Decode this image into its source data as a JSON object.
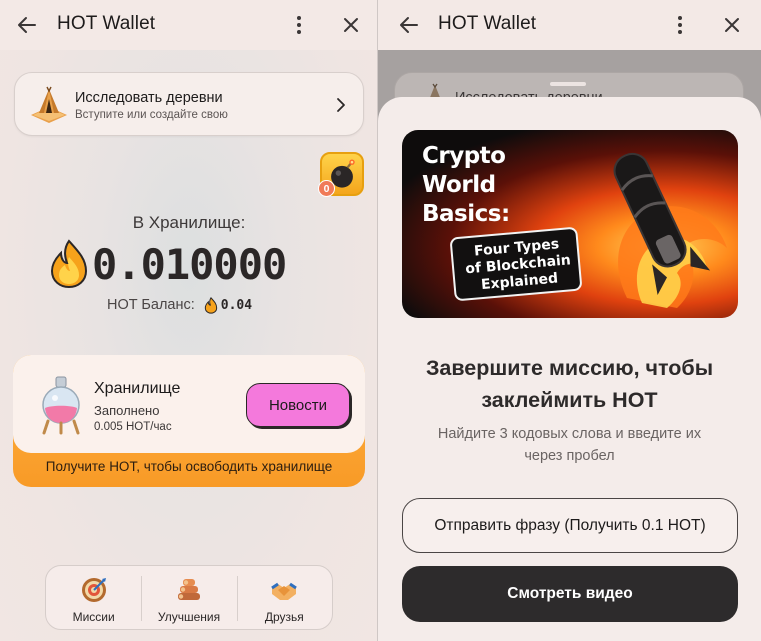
{
  "left": {
    "window": {
      "title": "HOT Wallet"
    },
    "explore": {
      "title": "Исследовать деревни",
      "subtitle": "Вступите или создайте свою"
    },
    "bomb_badge": {
      "count": "0"
    },
    "vault": {
      "label": "В Хранилище:",
      "amount": "0.010000"
    },
    "balance": {
      "label": "HOT Баланс:",
      "value": "0.04"
    },
    "storage": {
      "title": "Хранилище",
      "state": "Заполнено",
      "rate": "0.005 HOT/час",
      "button": "Новости",
      "footer": "Получите HOT, чтобы освободить хранилище"
    },
    "nav": [
      {
        "label": "Миссии",
        "icon": "dartboard-icon"
      },
      {
        "label": "Улучшения",
        "icon": "logs-icon"
      },
      {
        "label": "Друзья",
        "icon": "handshake-icon"
      }
    ]
  },
  "right": {
    "window": {
      "title": "HOT Wallet"
    },
    "behind_card": {
      "title": "Исследовать деревни"
    },
    "video": {
      "title": "Crypto\nWorld\nBasics:",
      "box_text": "Four Types\nof Blockchain\nExplained"
    },
    "mission": {
      "title": "Завершите миссию, чтобы\nзаклеймить HOT",
      "subtitle": "Найдите 3 кодовых слова и введите их\nчерез пробел"
    },
    "buttons": {
      "send": "Отправить фразу (Получить 0.1 HOT)",
      "watch": "Смотреть видео"
    }
  },
  "colors": {
    "news_button": "#f479dc",
    "storage_card": "#f89a26",
    "watch_button": "#2d2b2c",
    "bomb_badge": "#ffd34a"
  }
}
